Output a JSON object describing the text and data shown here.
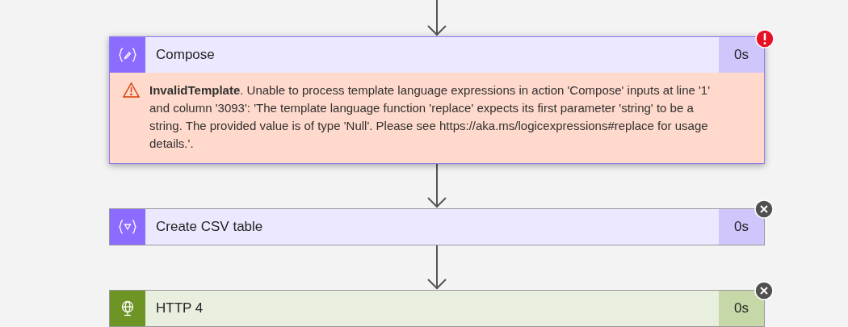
{
  "steps": [
    {
      "kind": "data-operation",
      "title": "Compose",
      "duration": "0s",
      "badge": {
        "kind": "error"
      },
      "selected": true,
      "error": "**InvalidTemplate**. Unable to process template language expressions in action 'Compose' inputs at line '1' and column '3093': 'The template language function 'replace' expects its first parameter 'string' to be a string. The provided value is of type 'Null'. Please see https://aka.ms/logicexpressions#replace for usage details.'."
    },
    {
      "kind": "data-operation",
      "title": "Create CSV table",
      "duration": "0s",
      "badge": {
        "kind": "skipped"
      },
      "selected": false
    },
    {
      "kind": "http",
      "title": "HTTP 4",
      "duration": "0s",
      "badge": {
        "kind": "skipped"
      },
      "selected": false
    }
  ]
}
